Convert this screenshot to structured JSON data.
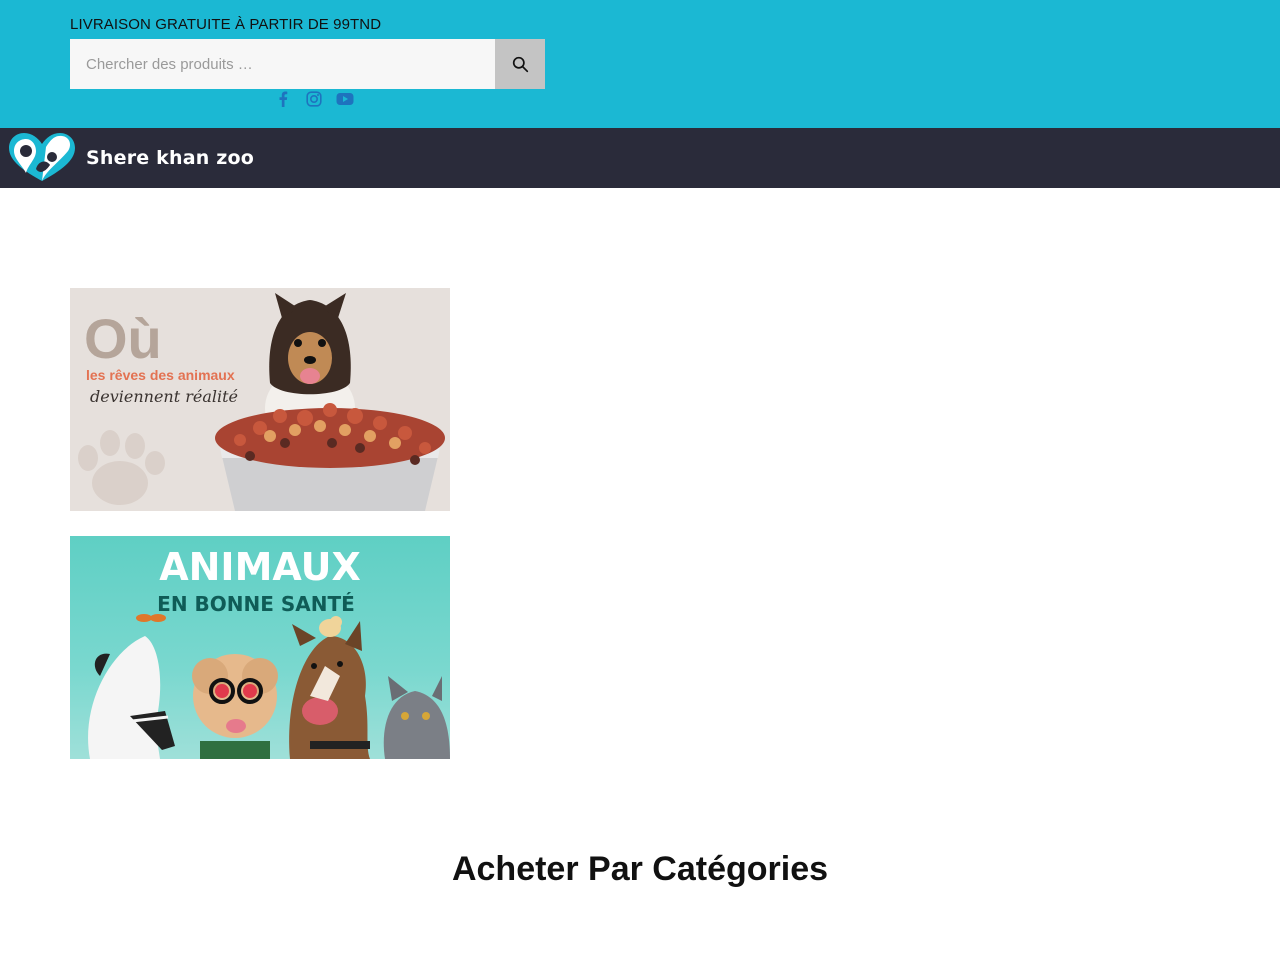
{
  "header": {
    "promo_text": "LIVRAISON GRATUITE À PARTIR DE 99TND",
    "search": {
      "placeholder": "Chercher des produits …",
      "value": ""
    },
    "social": [
      "facebook-icon",
      "instagram-icon",
      "youtube-icon"
    ],
    "accent_color": "#1bb8d3",
    "social_color": "#1e73be"
  },
  "navbar": {
    "brand": "Shere khan zoo",
    "background": "#2a2b3a"
  },
  "banners": [
    {
      "headline": "Où",
      "line1": "les rêves des animaux",
      "line2": "deviennent réalité"
    },
    {
      "headline": "ANIMAUX",
      "subline": "EN BONNE SANTÉ"
    }
  ],
  "main": {
    "section_title": "Acheter Par Catégories"
  }
}
